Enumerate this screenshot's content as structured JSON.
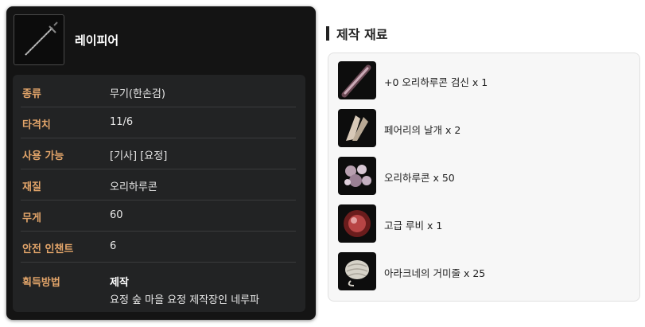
{
  "item": {
    "name": "레이피어",
    "icon": "rapier-icon",
    "rows": [
      {
        "label": "종류",
        "value": "무기(한손검)"
      },
      {
        "label": "타격치",
        "value": "11/6"
      },
      {
        "label": "사용 가능",
        "value": "[기사] [요정]"
      },
      {
        "label": "재질",
        "value": "오리하루콘"
      },
      {
        "label": "무게",
        "value": "60"
      },
      {
        "label": "안전 인챈트",
        "value": "6"
      },
      {
        "label": "획득방법",
        "value": "제작",
        "sub": "요정 숲 마을 요정 제작장인 네루파"
      }
    ]
  },
  "materials": {
    "title": "제작 재료",
    "items": [
      {
        "label": "+0 오리하루콘 검신 x 1",
        "icon": "sword-blade-icon"
      },
      {
        "label": "페어리의 날개 x 2",
        "icon": "fairy-wing-icon"
      },
      {
        "label": "오리하루콘 x 50",
        "icon": "orichalcum-ore-icon"
      },
      {
        "label": "고급 루비 x 1",
        "icon": "ruby-icon"
      },
      {
        "label": "아라크네의 거미줄 x 25",
        "icon": "spider-silk-icon"
      }
    ]
  },
  "colors": {
    "label": "#e3a56a",
    "card": "#141414",
    "panel": "#222324"
  }
}
